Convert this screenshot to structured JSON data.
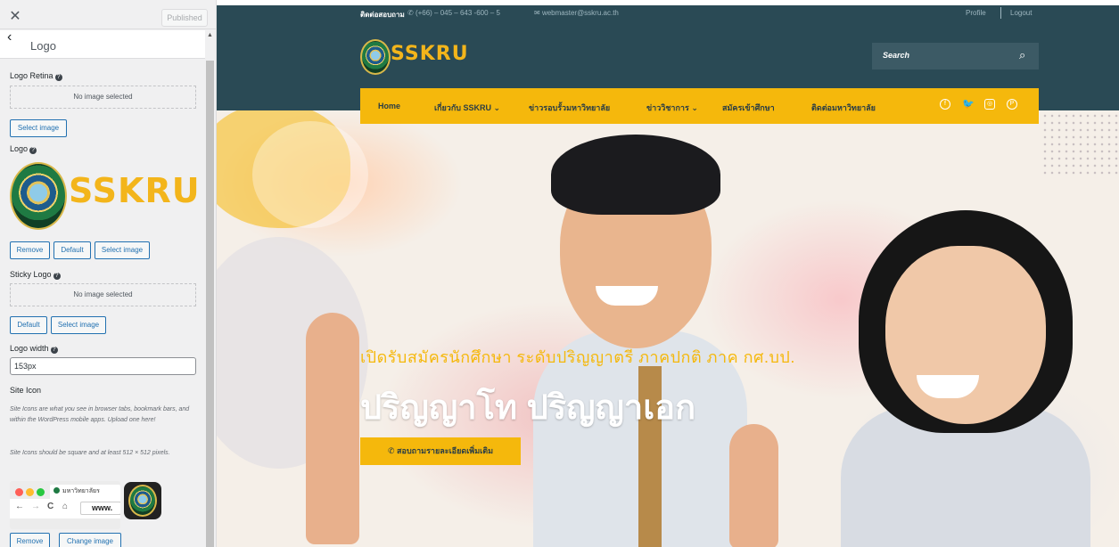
{
  "panel": {
    "close_icon": "close-icon",
    "publish_label": "Published",
    "back_icon": "chevron-left-icon",
    "section_title": "Logo",
    "logo_retina": {
      "label": "Logo Retina",
      "help": "?",
      "placeholder": "No image selected",
      "select_label": "Select image"
    },
    "logo": {
      "label": "Logo",
      "help": "?",
      "brand": "SSKRU",
      "remove_label": "Remove",
      "default_label": "Default",
      "select_label": "Select image"
    },
    "sticky_logo": {
      "label": "Sticky Logo",
      "help": "?",
      "placeholder": "No image selected",
      "default_label": "Default",
      "select_label": "Select image"
    },
    "logo_width": {
      "label": "Logo width",
      "help": "?",
      "value": "153px"
    },
    "site_icon": {
      "label": "Site Icon",
      "desc1": "Site Icons are what you see in browser tabs, bookmark bars, and within the WordPress mobile apps. Upload one here!",
      "desc2": "Site Icons should be square and at least 512 × 512 pixels.",
      "tab_text": "มหาวิทยาลัยร",
      "url_text": "www.",
      "remove_label": "Remove",
      "change_label": "Change image",
      "dot_colors": [
        "#ff5f57",
        "#febc2e",
        "#28c840"
      ]
    }
  },
  "site": {
    "topbar": {
      "contact_label": "ติดต่อสอบถาม",
      "phone": "(+66) – 045 – 643 -600 – 5",
      "email": "webmaster@sskru.ac.th",
      "profile": "Profile",
      "logout": "Logout"
    },
    "brand": "SSKRU",
    "search_placeholder": "Search",
    "nav": [
      "Home",
      "เกี่ยวกับ SSKRU",
      "ข่าวรอบรั้วมหาวิทยาลัย",
      "ข่าววิชาการ",
      "สมัครเข้าศึกษา",
      "ติดต่อมหาวิทยาลัย"
    ],
    "hero_subtitle": "เปิดรับสมัครนักศึกษา ระดับปริญญาตรี ภาคปกติ ภาค กศ.บป.",
    "hero_title": "ปริญญาโท ปริญญาเอก",
    "cta_label": "สอบถามรายละเอียดเพิ่มเติม",
    "colors": {
      "header": "#2a4a55",
      "accent": "#f5b80c",
      "button_blue": "#2271b1"
    }
  }
}
